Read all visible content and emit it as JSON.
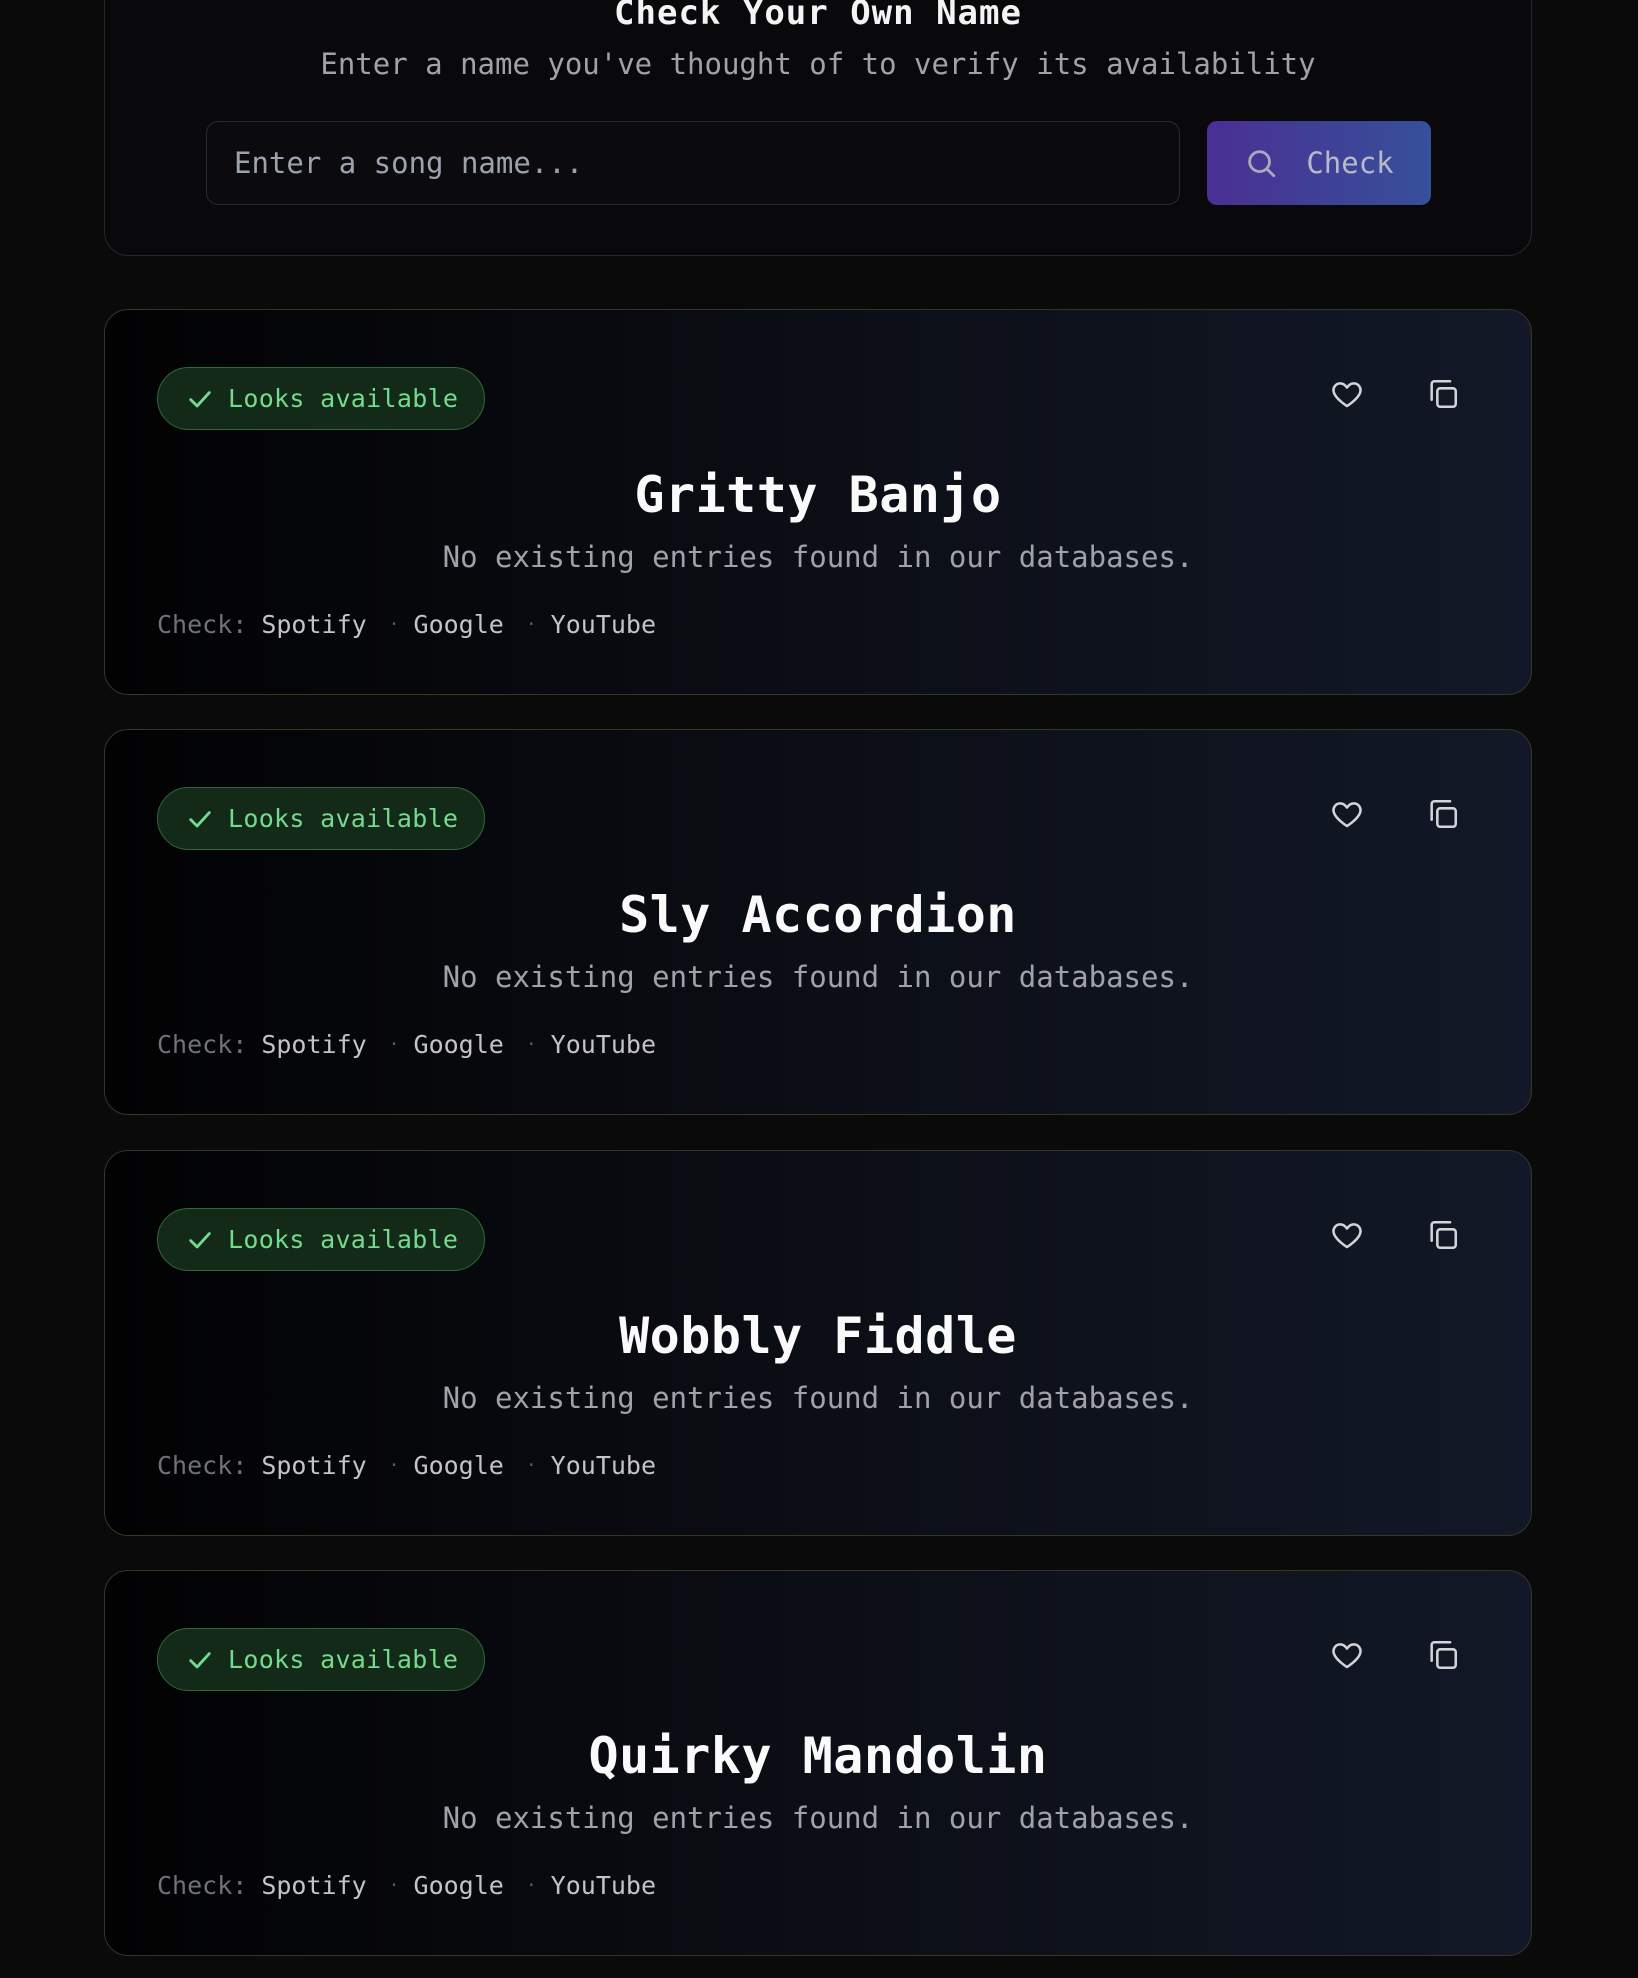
{
  "check_panel": {
    "title": "Check Your Own Name",
    "subtitle": "Enter a name you've thought of to verify its availability",
    "input_placeholder": "Enter a song name...",
    "input_value": "",
    "button_label": "Check",
    "button_icon": "search-icon"
  },
  "cards": [
    {
      "badge": "Looks available",
      "title": "Gritty Banjo",
      "description": "No existing entries found in our databases.",
      "check_label": "Check:",
      "links": [
        "Spotify",
        "Google",
        "YouTube"
      ]
    },
    {
      "badge": "Looks available",
      "title": "Sly Accordion",
      "description": "No existing entries found in our databases.",
      "check_label": "Check:",
      "links": [
        "Spotify",
        "Google",
        "YouTube"
      ]
    },
    {
      "badge": "Looks available",
      "title": "Wobbly Fiddle",
      "description": "No existing entries found in our databases.",
      "check_label": "Check:",
      "links": [
        "Spotify",
        "Google",
        "YouTube"
      ]
    },
    {
      "badge": "Looks available",
      "title": "Quirky Mandolin",
      "description": "No existing entries found in our databases.",
      "check_label": "Check:",
      "links": [
        "Spotify",
        "Google",
        "YouTube"
      ]
    }
  ],
  "card_icons": {
    "badge_icon": "check-icon",
    "favorite_icon": "heart-icon",
    "copy_icon": "copy-icon"
  },
  "colors": {
    "background": "#0a0a0b",
    "badge_text": "#74db8e",
    "badge_bg": "#132a18",
    "button_gradient_start": "#4a2f94",
    "button_gradient_end": "#36509a",
    "card_border": "#3a3424"
  }
}
